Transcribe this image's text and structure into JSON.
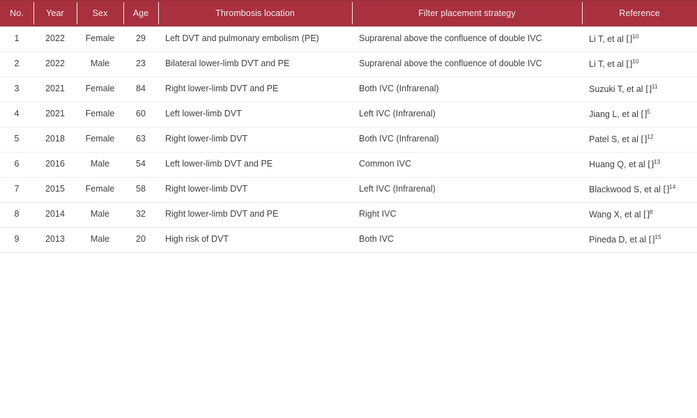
{
  "table": {
    "columns": [
      {
        "key": "no",
        "label": "No."
      },
      {
        "key": "year",
        "label": "Year"
      },
      {
        "key": "sex",
        "label": "Sex"
      },
      {
        "key": "age",
        "label": "Age"
      },
      {
        "key": "loc",
        "label": "Thrombosis location"
      },
      {
        "key": "fps",
        "label": "Filter placement strategy"
      },
      {
        "key": "ref",
        "label": "Reference"
      }
    ],
    "rows": [
      {
        "no": "1",
        "year": "2022",
        "sex": "Female",
        "age": "29",
        "loc": "Left DVT and pulmonary embolism (PE)",
        "fps": "Suprarenal above the confluence of double IVC",
        "ref_author": "Li T, et al ",
        "ref_glyph": "[]",
        "ref_sup": "10"
      },
      {
        "no": "2",
        "year": "2022",
        "sex": "Male",
        "age": "23",
        "loc": "Bilateral lower-limb DVT and PE",
        "fps": "Suprarenal above the confluence of double IVC",
        "ref_author": "Li T, et al ",
        "ref_glyph": "[]",
        "ref_sup": "10"
      },
      {
        "no": "3",
        "year": "2021",
        "sex": "Female",
        "age": "84",
        "loc": "Right lower-limb DVT and PE",
        "fps": "Both IVC (Infrarenal)",
        "ref_author": "Suzuki T, et al ",
        "ref_glyph": "[]",
        "ref_sup": "11"
      },
      {
        "no": "4",
        "year": "2021",
        "sex": "Female",
        "age": "60",
        "loc": "Left lower-limb DVT",
        "fps": "Left IVC (Infrarenal)",
        "ref_author": "Jiang L, et al ",
        "ref_glyph": "[]",
        "ref_sup": "5"
      },
      {
        "no": "5",
        "year": "2018",
        "sex": "Female",
        "age": "63",
        "loc": "Right lower-limb DVT",
        "fps": "Both IVC (Infrarenal)",
        "ref_author": "Patel S, et al ",
        "ref_glyph": "[]",
        "ref_sup": "12"
      },
      {
        "no": "6",
        "year": "2016",
        "sex": "Male",
        "age": "54",
        "loc": "Left lower-limb DVT and PE",
        "fps": "Common IVC",
        "ref_author": "Huang Q, et al ",
        "ref_glyph": "[]",
        "ref_sup": "13"
      },
      {
        "no": "7",
        "year": "2015",
        "sex": "Female",
        "age": "58",
        "loc": "Right lower-limb DVT",
        "fps": "Left IVC (Infrarenal)",
        "ref_author": "Blackwood S, et al ",
        "ref_glyph": "[]",
        "ref_sup": "14"
      },
      {
        "no": "8",
        "year": "2014",
        "sex": "Male",
        "age": "32",
        "loc": "Right lower-limb DVT and PE",
        "fps": "Right IVC",
        "ref_author": "Wang X, et al ",
        "ref_glyph": "[]",
        "ref_sup": "8"
      },
      {
        "no": "9",
        "year": "2013",
        "sex": "Male",
        "age": "20",
        "loc": "High risk of DVT",
        "fps": "Both IVC",
        "ref_author": "Pineda D, et al ",
        "ref_glyph": "[]",
        "ref_sup": "15"
      }
    ]
  },
  "colors": {
    "header_bg": "#a8303f",
    "header_text": "#f6eded",
    "body_text": "#3f3f3f",
    "row_divider": "#ececec",
    "page_bg": "#ffffff"
  }
}
